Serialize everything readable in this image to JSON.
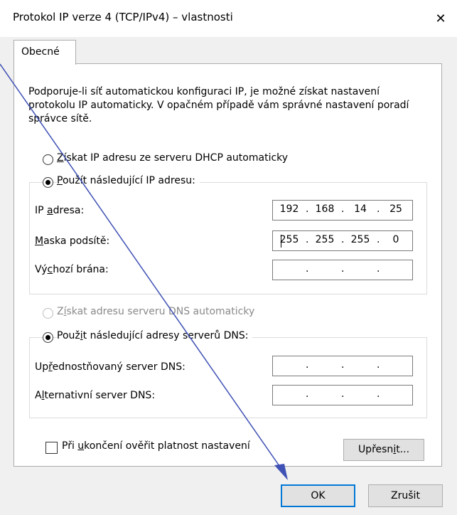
{
  "window": {
    "title": "Protokol IP verze 4 (TCP/IPv4) – vlastnosti",
    "close_glyph": "✕"
  },
  "tabs": [
    {
      "label": "Obecné",
      "active": true
    }
  ],
  "intro_text": "Podporuje-li síť automatickou konfiguraci IP, je možné získat nastavení protokolu IP automaticky. V opačném případě vám správné nastavení poradí správce sítě.",
  "ip_section": {
    "auto_option": {
      "label_pre": "",
      "label_ul": "Z",
      "label_post": "ískat IP adresu ze serveru DHCP automaticky",
      "checked": false
    },
    "manual_option": {
      "label_pre": "",
      "label_ul": "P",
      "label_post": "oužít následující IP adresu:",
      "checked": true
    },
    "fields": [
      {
        "label_pre": "IP ",
        "label_ul": "a",
        "label_post": "dresa:",
        "octets": [
          "192",
          "168",
          "14",
          "25"
        ]
      },
      {
        "label_pre": "",
        "label_ul": "M",
        "label_post": "aska podsítě:",
        "octets": [
          "255",
          "255",
          "255",
          "0"
        ]
      },
      {
        "label_pre": "Vý",
        "label_ul": "c",
        "label_post": "hozí brána:",
        "octets": [
          "",
          "",
          "",
          ""
        ]
      }
    ]
  },
  "dns_section": {
    "auto_option": {
      "label_pre": "Z",
      "label_ul": "í",
      "label_post": "skat adresu serveru DNS automaticky",
      "checked": false,
      "disabled": true
    },
    "manual_option": {
      "label_pre": "Použ",
      "label_ul": "i",
      "label_post": "t následující adresy serverů DNS:",
      "checked": true
    },
    "fields": [
      {
        "label_pre": "Up",
        "label_ul": "ř",
        "label_post": "ednostňovaný server DNS:",
        "octets": [
          "",
          "",
          "",
          ""
        ]
      },
      {
        "label_pre": "A",
        "label_ul": "l",
        "label_post": "ternativní server DNS:",
        "octets": [
          "",
          "",
          "",
          ""
        ]
      }
    ]
  },
  "validate_checkbox": {
    "label_pre": "Při ",
    "label_ul": "u",
    "label_post": "končení ověřit platnost nastavení",
    "checked": false
  },
  "advanced_button": {
    "label_pre": "Upřesn",
    "label_ul": "i",
    "label_post": "t..."
  },
  "ok_button": "OK",
  "cancel_button": "Zrušit",
  "colors": {
    "annotation_arrow": "#3f51b5",
    "default_button_border": "#0078d7"
  }
}
